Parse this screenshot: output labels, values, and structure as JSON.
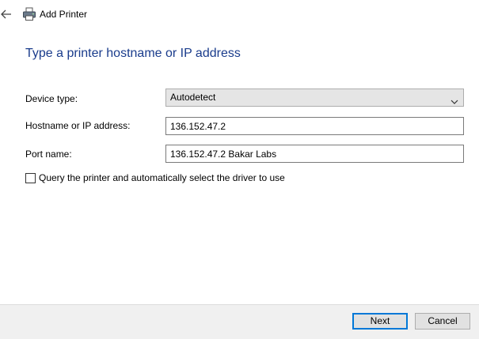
{
  "window": {
    "title": "Add Printer",
    "back_icon": "back-arrow-icon",
    "app_icon": "printer-icon"
  },
  "page": {
    "heading": "Type a printer hostname or IP address"
  },
  "form": {
    "device_type": {
      "label": "Device type:",
      "value": "Autodetect"
    },
    "hostname": {
      "label": "Hostname or IP address:",
      "value": "136.152.47.2"
    },
    "port_name": {
      "label": "Port name:",
      "value": "136.152.47.2 Bakar Labs"
    },
    "query_checkbox": {
      "label": "Query the printer and automatically select the driver to use",
      "checked": false
    }
  },
  "footer": {
    "next_label": "Next",
    "cancel_label": "Cancel"
  },
  "colors": {
    "heading": "#1a3c8c",
    "accent": "#0078d7",
    "footer_bg": "#f0f0f0"
  }
}
